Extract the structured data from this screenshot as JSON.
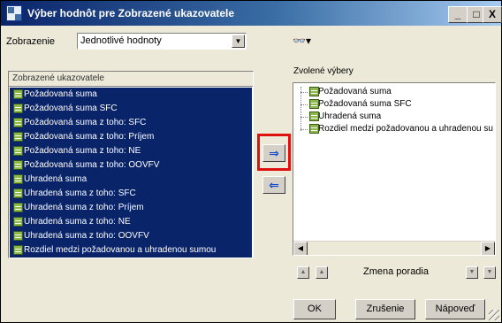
{
  "window": {
    "title": "Výber hodnôt pre Zobrazené ukazovatele"
  },
  "titlebar": {
    "min": "_",
    "max": "□",
    "close": "X"
  },
  "display": {
    "label": "Zobrazenie",
    "selected": "Jednotlivé hodnoty"
  },
  "tools": {
    "icon": "glasses-icon",
    "dropdown": "▾"
  },
  "available": {
    "header": "Zobrazené ukazovatele",
    "items": [
      "Požadovaná suma",
      "Požadovaná suma SFC",
      "Požadovaná suma z toho: SFC",
      "Požadovaná suma z toho: Príjem",
      "Požadovaná suma z toho: NE",
      "Požadovaná suma z toho: OOVFV",
      "Uhradená suma",
      "Uhradená suma z toho: SFC",
      "Uhradená suma z toho: Príjem",
      "Uhradená suma z toho: NE",
      "Uhradená suma z toho: OOVFV",
      "Rozdiel medzi požadovanou a uhradenou sumou"
    ]
  },
  "selected": {
    "header": "Zvolené výbery",
    "items": [
      "Požadovaná suma",
      "Požadovaná suma SFC",
      "Uhradená suma",
      "Rozdiel medzi požadovanou a uhradenou su"
    ]
  },
  "transfer": {
    "add_glyph": "⇒",
    "remove_glyph": "⇐"
  },
  "order": {
    "label": "Zmena poradia"
  },
  "buttons": {
    "ok": "OK",
    "cancel": "Zrušenie",
    "help": "Nápoveď"
  },
  "colors": {
    "selection": "#0a246a",
    "highlight": "#e01010",
    "item_icon": "#8cb84a"
  }
}
